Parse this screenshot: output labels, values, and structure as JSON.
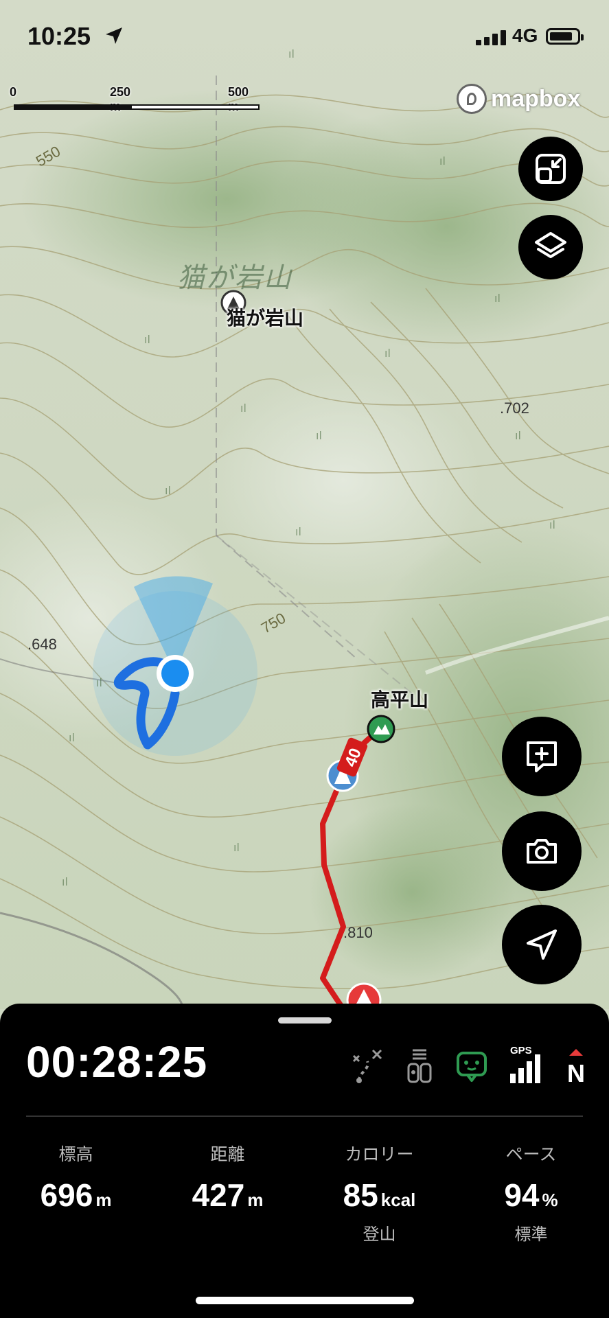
{
  "status_bar": {
    "time": "10:25",
    "network": "4G"
  },
  "scale": {
    "labels": [
      "0",
      "250 m",
      "500 m"
    ]
  },
  "map": {
    "attribution": "mapbox",
    "peak_faint_label": "猫が岩山",
    "peak_label": "猫が岩山",
    "destination_label": "高平山",
    "elevation_marks": [
      ".702",
      ".648",
      ".810",
      "750",
      "550"
    ],
    "route_marker_number": "40"
  },
  "controls": {
    "icons": {
      "resize": "resize-icon",
      "layers": "layers-icon",
      "add_note": "add-note-icon",
      "camera": "camera-icon",
      "navigate": "navigation-arrow-icon"
    }
  },
  "panel": {
    "timer": "00:28:25",
    "gps_label": "GPS",
    "compass_label": "N",
    "status_icons": [
      "route-off-icon",
      "tracking-icon",
      "bear-bell-icon",
      "gps-signal-icon",
      "compass-north-icon"
    ],
    "stats": [
      {
        "label": "標高",
        "value": "696",
        "unit": "m",
        "sub": ""
      },
      {
        "label": "距離",
        "value": "427",
        "unit": "m",
        "sub": ""
      },
      {
        "label": "カロリー",
        "value": "85",
        "unit": "kcal",
        "sub": "登山"
      },
      {
        "label": "ペース",
        "value": "94",
        "unit": "%",
        "sub": "標準"
      }
    ]
  },
  "colors": {
    "panel_bg": "#000000",
    "track_red": "#d41c1c",
    "my_track_blue": "#1e6fe0",
    "location_dot": "#1a8df0",
    "peak_green": "#2f9b52"
  }
}
